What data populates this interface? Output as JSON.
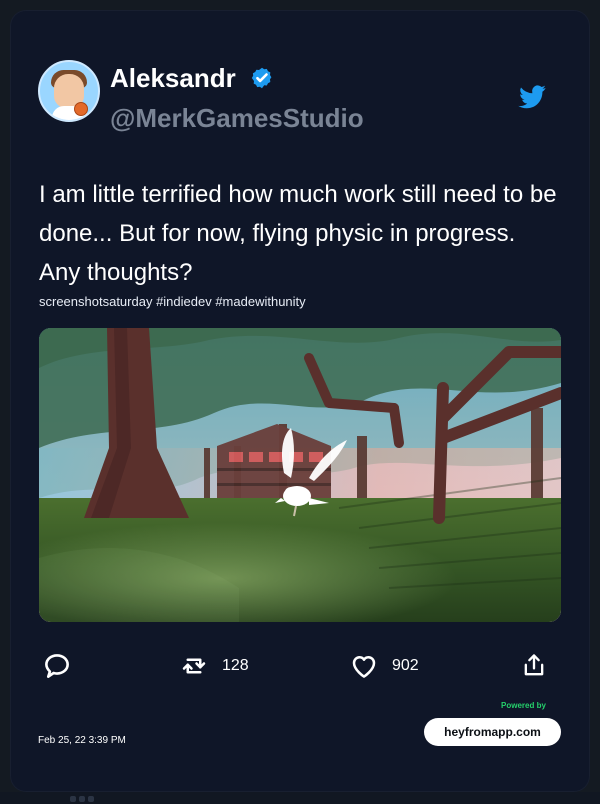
{
  "author": {
    "name": "Aleksandr",
    "handle": "@MerkGamesStudio",
    "verified": true
  },
  "tweet": {
    "text": "I am little terrified how much work still need to be done... But for now, flying physic in progress. Any thoughts?",
    "hashtags_line": "screenshotsaturday #indiedev #madewithunity",
    "timestamp": "Feb 25, 22 3:39 PM"
  },
  "actions": {
    "reply_icon": "reply-icon",
    "retweet_icon": "retweet-icon",
    "like_icon": "heart-icon",
    "share_icon": "share-icon",
    "retweets": "128",
    "likes": "902"
  },
  "branding": {
    "powered_by": "Powered by",
    "site": "heyfromapp.com",
    "accent": "#25d06b"
  },
  "icons": {
    "verified": "verified-badge-icon",
    "twitter": "twitter-bird-icon"
  },
  "colors": {
    "card_bg": "#0f1628",
    "text_primary": "#ffffff",
    "text_secondary": "#7a8495",
    "twitter_blue": "#1d9bf0"
  }
}
